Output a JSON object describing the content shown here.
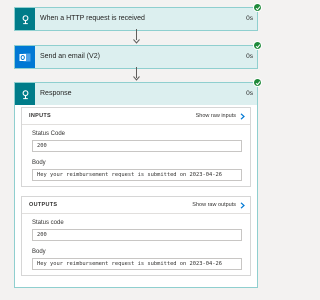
{
  "steps": [
    {
      "title": "When a HTTP request is received",
      "time": "0s",
      "icon": "http-trigger-icon"
    },
    {
      "title": "Send an email (V2)",
      "time": "0s",
      "icon": "outlook-icon"
    },
    {
      "title": "Response",
      "time": "0s",
      "icon": "response-icon"
    }
  ],
  "response": {
    "inputs": {
      "title": "INPUTS",
      "show_label": "Show raw inputs",
      "status_label": "Status Code",
      "status_value": "200",
      "body_label": "Body",
      "body_value": "Hey your reimbursement request is submitted on 2023-04-26"
    },
    "outputs": {
      "title": "OUTPUTS",
      "show_label": "Show raw outputs",
      "status_label": "Status code",
      "status_value": "200",
      "body_label": "Body",
      "body_value": "Hey your reimbursement request is submitted on 2023-04-26"
    }
  },
  "colors": {
    "step_bg": "#dcefef",
    "step_border": "#8fcfcf",
    "icon_bg": "#007c89",
    "outlook_blue": "#0078d4",
    "success_green": "#1f8a3b",
    "chevron_blue": "#0078d4"
  }
}
